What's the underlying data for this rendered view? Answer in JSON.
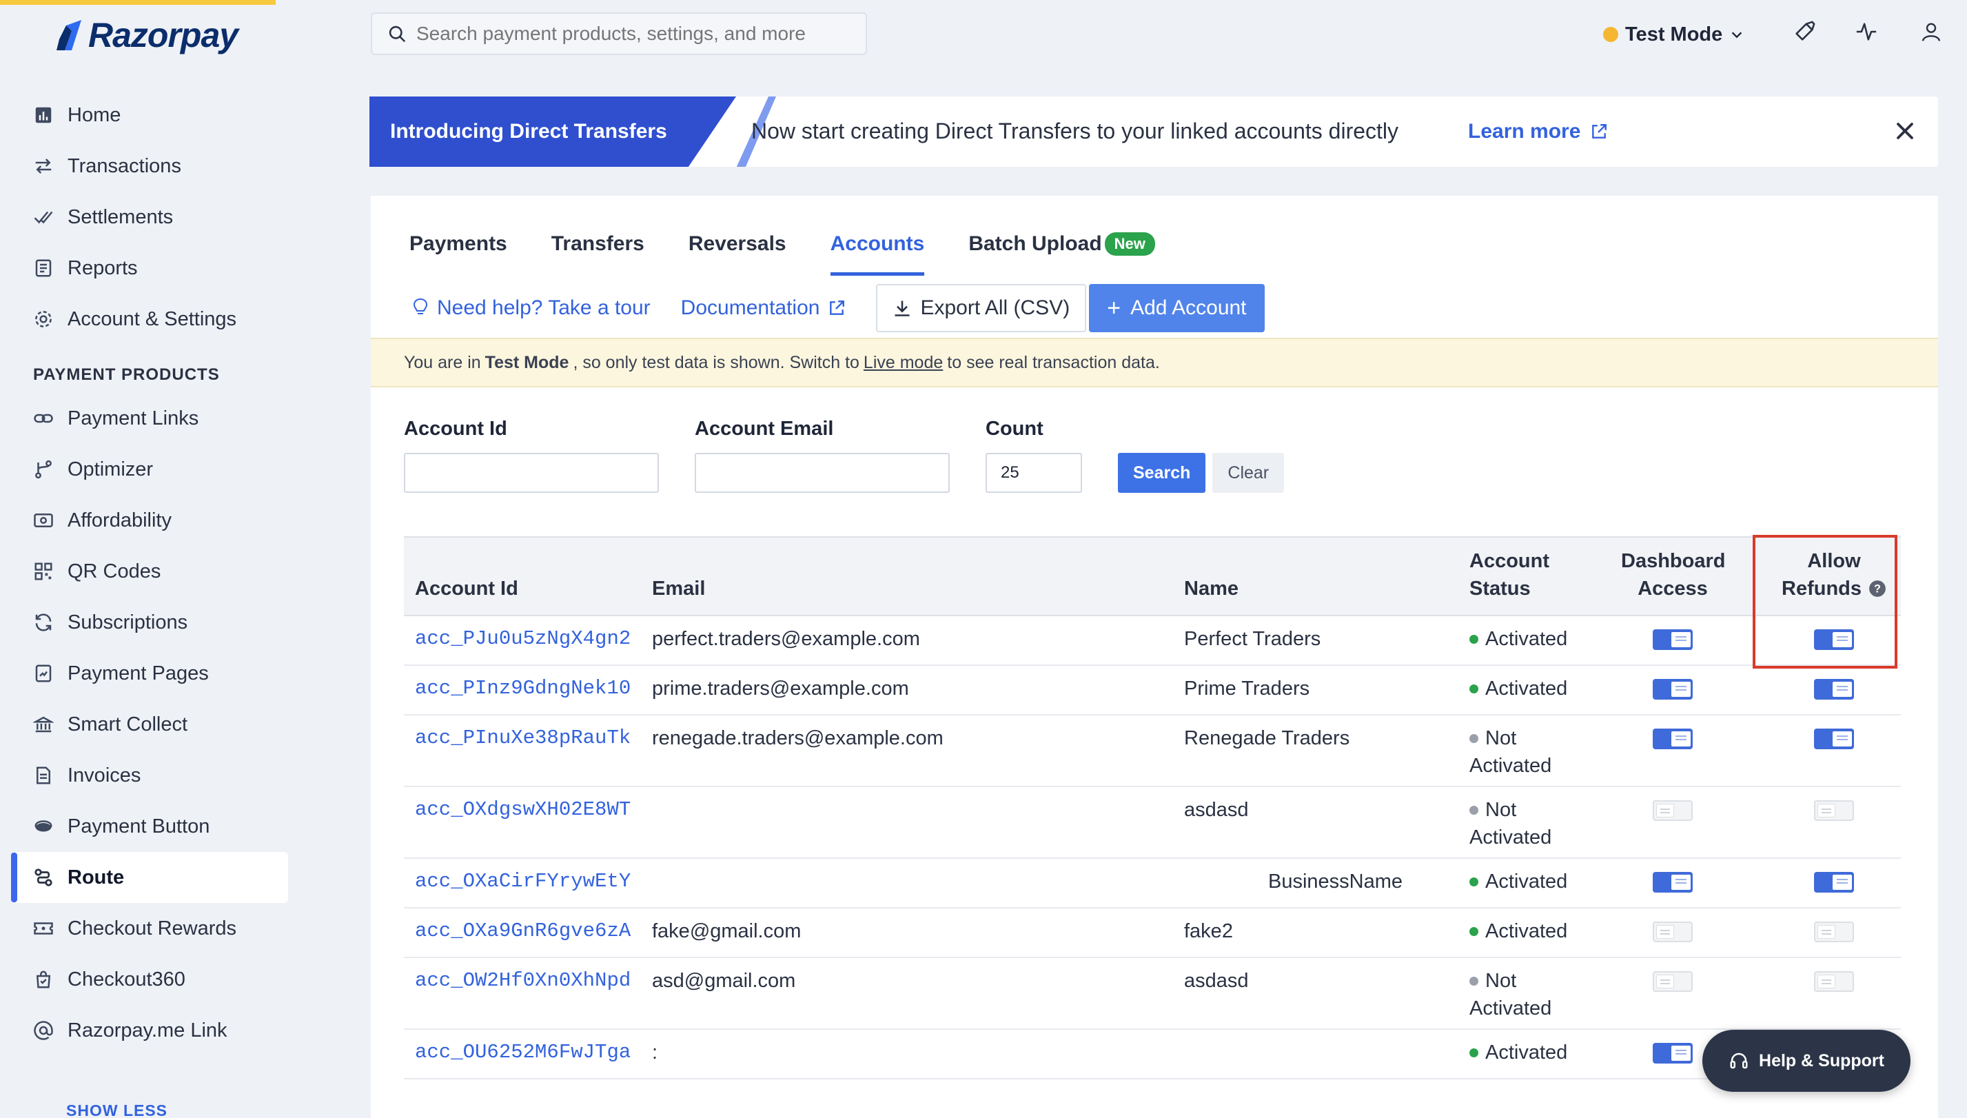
{
  "brand": {
    "name": "Razorpay"
  },
  "search": {
    "placeholder": "Search payment products, settings, and more"
  },
  "header": {
    "test_mode_label": "Test Mode"
  },
  "nav": {
    "main": [
      {
        "label": "Home",
        "icon": "chart-icon"
      },
      {
        "label": "Transactions",
        "icon": "transfer-arrows-icon"
      },
      {
        "label": "Settlements",
        "icon": "double-check-icon"
      },
      {
        "label": "Reports",
        "icon": "report-icon"
      },
      {
        "label": "Account & Settings",
        "icon": "gear-icon"
      }
    ],
    "section_label": "PAYMENT PRODUCTS",
    "products": [
      {
        "label": "Payment Links",
        "icon": "link-icon"
      },
      {
        "label": "Optimizer",
        "icon": "branch-icon"
      },
      {
        "label": "Affordability",
        "icon": "money-icon"
      },
      {
        "label": "QR Codes",
        "icon": "qr-icon"
      },
      {
        "label": "Subscriptions",
        "icon": "refresh-icon"
      },
      {
        "label": "Payment Pages",
        "icon": "page-icon"
      },
      {
        "label": "Smart Collect",
        "icon": "bank-icon"
      },
      {
        "label": "Invoices",
        "icon": "invoice-icon"
      },
      {
        "label": "Payment Button",
        "icon": "button-icon"
      },
      {
        "label": "Route",
        "icon": "route-icon",
        "active": true
      },
      {
        "label": "Checkout Rewards",
        "icon": "ticket-icon"
      },
      {
        "label": "Checkout360",
        "icon": "bag-icon"
      },
      {
        "label": "Razorpay.me Link",
        "icon": "at-icon"
      }
    ],
    "show_less": "SHOW LESS"
  },
  "banner": {
    "tag": "Introducing Direct Transfers",
    "text": "Now start creating Direct Transfers to your linked accounts directly",
    "link": "Learn more"
  },
  "tabs": [
    {
      "label": "Payments"
    },
    {
      "label": "Transfers"
    },
    {
      "label": "Reversals"
    },
    {
      "label": "Accounts",
      "active": true
    },
    {
      "label": "Batch Upload",
      "badge": "New"
    }
  ],
  "actions": {
    "help": "Need help? Take a tour",
    "docs": "Documentation",
    "export": "Export All (CSV)",
    "add": "Add Account"
  },
  "notice": {
    "part1": "You are in",
    "bold": "Test Mode",
    "part2": ", so only test data is shown. Switch to",
    "link": "Live mode",
    "part3": "to see real transaction data."
  },
  "filters": {
    "account_id_label": "Account Id",
    "account_id_value": "",
    "email_label": "Account Email",
    "email_value": "",
    "count_label": "Count",
    "count_value": "25",
    "search_btn": "Search",
    "clear_btn": "Clear"
  },
  "table": {
    "headers": {
      "account_id": "Account Id",
      "email": "Email",
      "name": "Name",
      "status_l1": "Account",
      "status_l2": "Status",
      "dash_l1": "Dashboard",
      "dash_l2": "Access",
      "refund_l1": "Allow",
      "refund_l2": "Refunds"
    },
    "rows": [
      {
        "id": "acc_PJu0u5zNgX4gn2",
        "email": "perfect.traders@example.com",
        "name": "Perfect Traders",
        "status_l1": "Activated",
        "status_l2": "",
        "status_color": "#2ba24c",
        "dashboard": true,
        "refunds": true
      },
      {
        "id": "acc_PInz9GdngNek10",
        "email": "prime.traders@example.com",
        "name": "Prime Traders",
        "status_l1": "Activated",
        "status_l2": "",
        "status_color": "#2ba24c",
        "dashboard": true,
        "refunds": true
      },
      {
        "id": "acc_PInuXe38pRauTk",
        "email": "renegade.traders@example.com",
        "name": "Renegade Traders",
        "status_l1": "Not",
        "status_l2": "Activated",
        "status_color": "#9aa0aa",
        "dashboard": true,
        "refunds": true
      },
      {
        "id": "acc_OXdgswXH02E8WT",
        "email": "",
        "name": "asdasd",
        "status_l1": "Not",
        "status_l2": "Activated",
        "status_color": "#9aa0aa",
        "dashboard": false,
        "refunds": false
      },
      {
        "id": "acc_OXaCirFYrywEtY",
        "email": "",
        "name": "BusinessName",
        "status_l1": "Activated",
        "status_l2": "",
        "status_color": "#2ba24c",
        "dashboard": true,
        "refunds": true
      },
      {
        "id": "acc_OXa9GnR6gve6zA",
        "email": "fake@gmail.com",
        "name": "fake2",
        "status_l1": "Activated",
        "status_l2": "",
        "status_color": "#2ba24c",
        "dashboard": false,
        "refunds": false
      },
      {
        "id": "acc_OW2Hf0Xn0XhNpd",
        "email": "asd@gmail.com",
        "name": "asdasd",
        "status_l1": "Not",
        "status_l2": "Activated",
        "status_color": "#9aa0aa",
        "dashboard": false,
        "refunds": false
      },
      {
        "id": "acc_OU6252M6FwJTga",
        "email": ":",
        "name": "",
        "status_l1": "Activated",
        "status_l2": "",
        "status_color": "#2ba24c",
        "dashboard": true,
        "refunds": false
      }
    ]
  },
  "help_support": "Help & Support",
  "colors": {
    "accent": "#3262dd",
    "activated": "#2ba24c",
    "highlight": "#d93a2b"
  }
}
